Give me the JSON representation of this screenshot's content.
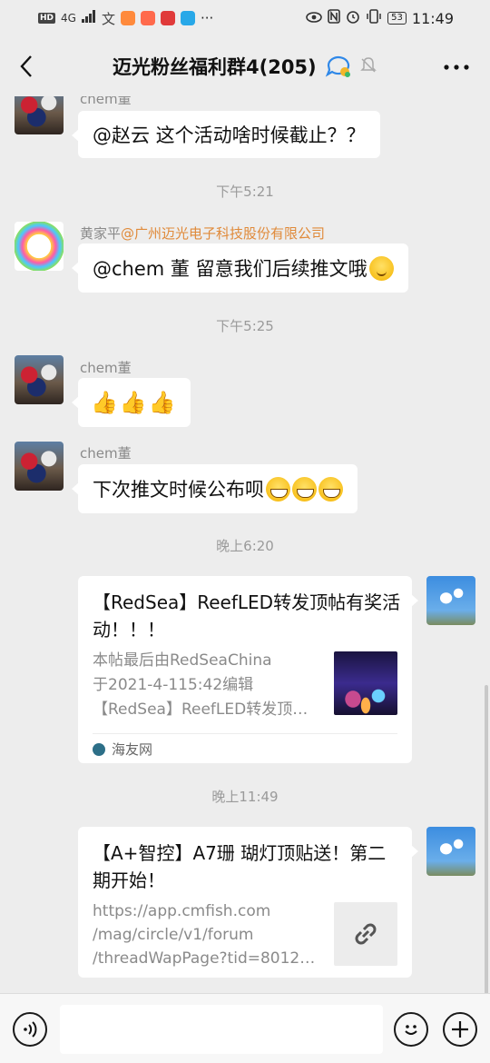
{
  "status_bar": {
    "left_badge": "HD",
    "network": "4G",
    "time": "11:49",
    "battery": "53",
    "more": "···"
  },
  "header": {
    "title": "迈光粉丝福利群4(205)"
  },
  "messages": {
    "m1": {
      "sender": "chem董",
      "text": "@赵云  这个活动啥时候截止？？"
    },
    "t1": "下午5:21",
    "m2": {
      "sender": "黄家平",
      "sender_tag": "@广州迈光电子科技股份有限公司",
      "text": "@chem 董 留意我们后续推文哦"
    },
    "t2": "下午5:25",
    "m3": {
      "sender": "chem董",
      "text": ""
    },
    "m4": {
      "sender": "chem董",
      "text": "下次推文时候公布呗"
    },
    "t3": "晚上6:20",
    "card1": {
      "title": "【RedSea】ReefLED转发顶帖有奖活动！！！",
      "desc_line1": "本帖最后由RedSeaChina",
      "desc_line2": "于2021-4-115:42编辑",
      "desc_line3": "【RedSea】ReefLED转发顶…",
      "source": "海友网"
    },
    "t4": "晚上11:49",
    "card2": {
      "title": "【A+智控】A7珊 瑚灯顶贴送！第二期开始！",
      "desc_line1": "https://app.cmfish.com",
      "desc_line2": "/mag/circle/v1/forum",
      "desc_line3": "/threadWapPage?tid=80121…"
    }
  },
  "input": {
    "placeholder": ""
  }
}
